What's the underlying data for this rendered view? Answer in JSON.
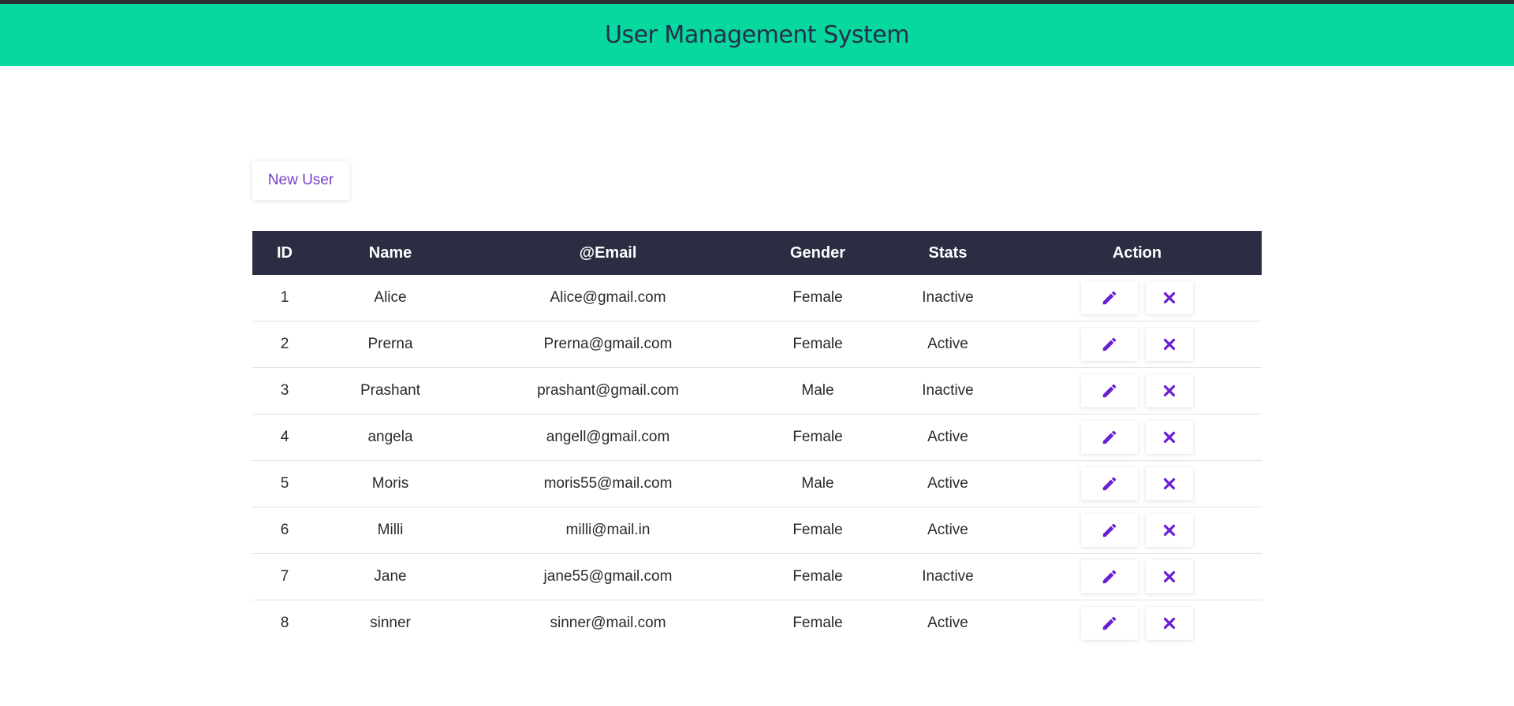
{
  "header": {
    "title": "User Management System"
  },
  "toolbar": {
    "new_user_label": "New User"
  },
  "table": {
    "columns": [
      "ID",
      "Name",
      "@Email",
      "Gender",
      "Stats",
      "Action"
    ],
    "rows": [
      {
        "id": "1",
        "name": "Alice",
        "email": "Alice@gmail.com",
        "gender": "Female",
        "stats": "Inactive"
      },
      {
        "id": "2",
        "name": "Prerna",
        "email": "Prerna@gmail.com",
        "gender": "Female",
        "stats": "Active"
      },
      {
        "id": "3",
        "name": "Prashant",
        "email": "prashant@gmail.com",
        "gender": "Male",
        "stats": "Inactive"
      },
      {
        "id": "4",
        "name": "angela",
        "email": "angell@gmail.com",
        "gender": "Female",
        "stats": "Active"
      },
      {
        "id": "5",
        "name": "Moris",
        "email": "moris55@mail.com",
        "gender": "Male",
        "stats": "Active"
      },
      {
        "id": "6",
        "name": "Milli",
        "email": "milli@mail.in",
        "gender": "Female",
        "stats": "Active"
      },
      {
        "id": "7",
        "name": "Jane",
        "email": "jane55@gmail.com",
        "gender": "Female",
        "stats": "Inactive"
      },
      {
        "id": "8",
        "name": "sinner",
        "email": "sinner@mail.com",
        "gender": "Female",
        "stats": "Active"
      }
    ],
    "row_actions": [
      {
        "icon": "pencil-icon",
        "name": "edit-button"
      },
      {
        "icon": "close-icon",
        "name": "delete-button"
      }
    ]
  },
  "colors": {
    "header_bg": "#06d89f",
    "header_text": "#263047",
    "table_head_bg": "#2b2d42",
    "accent_purple": "#6a1fd1",
    "button_text": "#7b3fc8"
  }
}
